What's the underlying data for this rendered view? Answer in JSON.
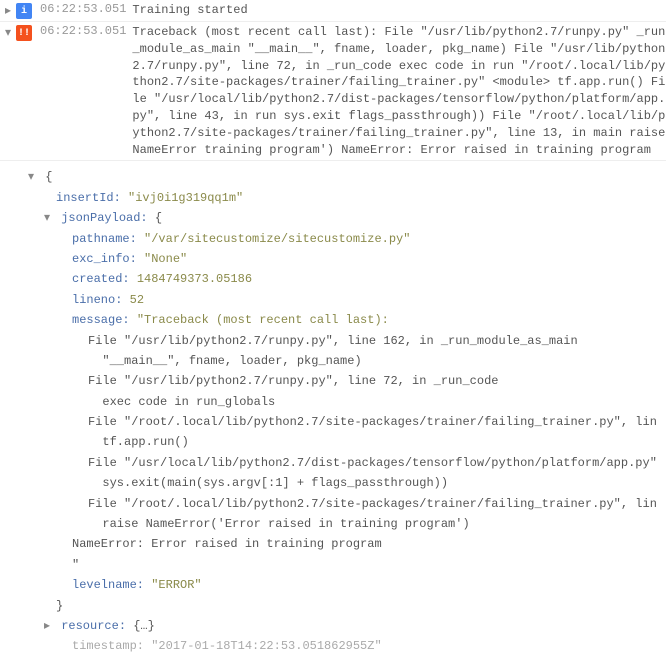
{
  "rows": [
    {
      "expander": "▸",
      "severity": "info",
      "sev_glyph": "i",
      "timestamp": "06:22:53.051",
      "message": "Training started"
    },
    {
      "expander": "▾",
      "severity": "error",
      "sev_glyph": "!!",
      "timestamp": "06:22:53.051",
      "message": "Traceback (most recent call last): File \"/usr/lib/python2.7/runpy.py\" _run_module_as_main \"__main__\", fname, loader, pkg_name) File \"/usr/lib/python2.7/runpy.py\", line 72, in _run_code exec code in run \"/root/.local/lib/python2.7/site-packages/trainer/failing_trainer.py\" <module> tf.app.run() File \"/usr/local/lib/python2.7/dist-packages/tensorflow/python/platform/app.py\", line 43, in run sys.exit flags_passthrough)) File \"/root/.local/lib/python2.7/site-packages/trainer/failing_trainer.py\", line 13, in main raise NameError training program') NameError: Error raised in training program"
    }
  ],
  "detail": {
    "open_brace": "{",
    "insertId": {
      "key": "insertId:",
      "value": "\"ivj0i1g319qq1m\""
    },
    "jsonPayload": {
      "key": "jsonPayload:",
      "brace": "{",
      "pathname": {
        "key": "pathname:",
        "value": "\"/var/sitecustomize/sitecustomize.py\""
      },
      "exc_info": {
        "key": "exc_info:",
        "value": "\"None\""
      },
      "created": {
        "key": "created:",
        "value": "1484749373.05186"
      },
      "lineno": {
        "key": "lineno:",
        "value": "52"
      },
      "message": {
        "key": "message:",
        "value": "\"Traceback (most recent call last):"
      },
      "tb": [
        "File \"/usr/lib/python2.7/runpy.py\", line 162, in _run_module_as_main",
        "  \"__main__\", fname, loader, pkg_name)",
        "File \"/usr/lib/python2.7/runpy.py\", line 72, in _run_code",
        "  exec code in run_globals",
        "File \"/root/.local/lib/python2.7/site-packages/trainer/failing_trainer.py\", lin",
        "  tf.app.run()",
        "File \"/usr/local/lib/python2.7/dist-packages/tensorflow/python/platform/app.py\"",
        "  sys.exit(main(sys.argv[:1] + flags_passthrough))",
        "File \"/root/.local/lib/python2.7/site-packages/trainer/failing_trainer.py\", lin",
        "  raise NameError('Error raised in training program')",
        "NameError: Error raised in training program",
        "\""
      ],
      "levelname": {
        "key": "levelname:",
        "value": "\"ERROR\""
      },
      "close_brace": "}"
    },
    "resource": {
      "caret": "▸",
      "key": "resource:",
      "value": "{…}"
    },
    "timestamp_cut": "timestamp: \"2017-01-18T14:22:53.051862955Z\""
  },
  "glyphs": {
    "down": "▾",
    "right": "▸"
  }
}
